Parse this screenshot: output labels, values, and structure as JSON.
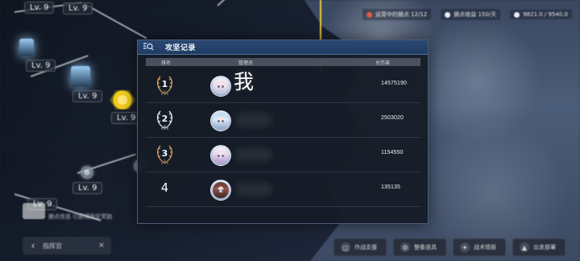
{
  "status_bar": [
    {
      "label": "运营中的据点 12/12",
      "icon": "red-flag-icon"
    },
    {
      "label": "据点收益 150/天",
      "icon": "resource-icon"
    },
    {
      "label": "9821.0 / 9540.0",
      "icon": "energy-icon"
    }
  ],
  "map": {
    "markers": [
      "Lv. 9",
      "Lv. 9",
      "Lv. 9",
      "Lv. 9",
      "Lv. 9",
      "Lv. 9",
      "Lv. 9"
    ]
  },
  "left_panel": {
    "info_text": "据点信息 已获得指定奖励",
    "tab_label": "指挥官"
  },
  "bottom_actions": [
    {
      "label": "作战支援"
    },
    {
      "label": "整备道具"
    },
    {
      "label": "战术情报"
    },
    {
      "label": "出发部署"
    }
  ],
  "modal": {
    "title": "攻坚记录",
    "headers": {
      "rank": "排名",
      "manager": "管理员",
      "damage": "总伤害"
    },
    "rows": [
      {
        "rank": "1",
        "name": "我",
        "damage": "14575190",
        "avatar_style": "avatar-hair-1"
      },
      {
        "rank": "2",
        "name": "",
        "damage": "2503020",
        "avatar_style": "avatar-hair-2"
      },
      {
        "rank": "3",
        "name": "",
        "damage": "1154550",
        "avatar_style": "avatar-hair-3"
      },
      {
        "rank": "4",
        "name": "",
        "damage": "135135",
        "avatar_style": "avatar-hair-4"
      }
    ]
  },
  "colors": {
    "accent_blue": "#2a4872",
    "yellow_route": "#f5d637",
    "modal_bg": "#161c27"
  }
}
